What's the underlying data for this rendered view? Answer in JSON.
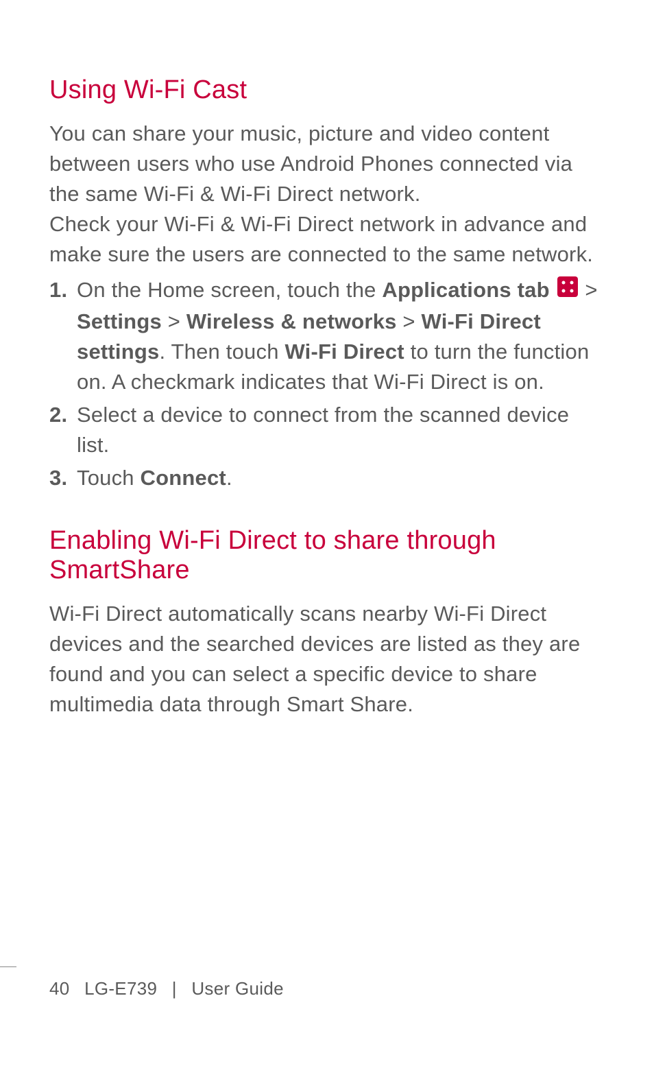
{
  "section1": {
    "heading": "Using Wi-Fi Cast",
    "para1": "You can share your music, picture and video content between users who use Android Phones connected via the same Wi-Fi & Wi-Fi Direct network.",
    "para2": "Check your Wi-Fi & Wi-Fi Direct network in advance and make sure the users are connected to the same network.",
    "steps": {
      "step1": {
        "pre": "On the Home screen, touch the ",
        "bold_apps_tab": "Applications tab",
        "gt1": " > ",
        "bold_settings": "Settings",
        "gt2": " > ",
        "bold_wireless": "Wireless & networks",
        "gt3": " > ",
        "bold_wifi_direct_settings": "Wi-Fi Direct settings",
        "mid": ". Then touch ",
        "bold_wifi_direct": "Wi-Fi Direct",
        "post": " to turn the function on. A checkmark indicates that Wi-Fi Direct is on."
      },
      "step2": "Select a device to connect from the scanned device list.",
      "step3": {
        "pre": "Touch ",
        "bold_connect": "Connect",
        "post": "."
      }
    }
  },
  "section2": {
    "heading": "Enabling Wi-Fi Direct to share through SmartShare",
    "para": "Wi-Fi Direct automatically scans nearby Wi-Fi Direct devices and the searched devices are listed as they are found and you can select a specific device to share multimedia data through Smart Share."
  },
  "footer": {
    "page": "40",
    "model": "LG-E739",
    "label": "User Guide"
  }
}
